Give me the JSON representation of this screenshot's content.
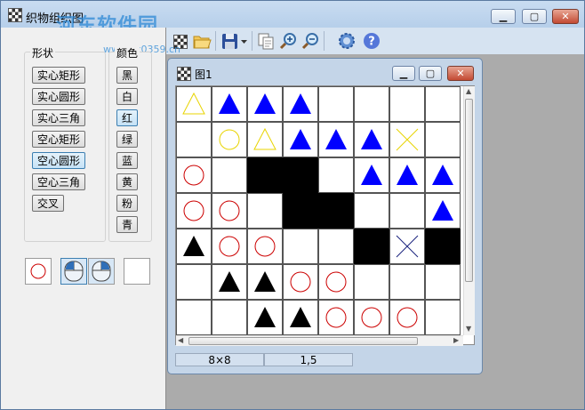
{
  "app": {
    "title": "织物组织图",
    "watermark": "河东软件园",
    "watermark_url": "www.pc0359.cn"
  },
  "toolbar": {
    "icons": [
      "grid-icon",
      "folder-open-icon",
      "save-icon",
      "dropdown-arrow-icon",
      "copy-icon",
      "zoom-in-icon",
      "zoom-out-icon",
      "settings-gear-icon",
      "help-icon"
    ]
  },
  "shape_group": {
    "label": "形状",
    "buttons": [
      "实心矩形",
      "实心圆形",
      "实心三角",
      "空心矩形",
      "空心圆形",
      "空心三角",
      "交叉"
    ],
    "selected": "空心圆形"
  },
  "color_group": {
    "label": "颜色",
    "buttons": [
      "黑",
      "白",
      "红",
      "绿",
      "蓝",
      "黄",
      "粉",
      "青"
    ],
    "selected": "红"
  },
  "child_window": {
    "title": "图1",
    "grid_size": 8,
    "cells": [
      [
        "tri-hollow-yellow",
        "tri-solid-blue",
        "tri-solid-blue",
        "tri-solid-blue",
        "",
        "",
        "",
        ""
      ],
      [
        "",
        "circle-hollow-yellow",
        "tri-hollow-yellow",
        "tri-solid-blue",
        "tri-solid-blue",
        "tri-solid-blue",
        "cross-yellow",
        ""
      ],
      [
        "circle-hollow-red",
        "",
        "rect-solid-black",
        "rect-solid-black",
        "",
        "tri-solid-blue",
        "tri-solid-blue",
        "tri-solid-blue"
      ],
      [
        "circle-hollow-red",
        "circle-hollow-red",
        "",
        "rect-solid-black",
        "rect-solid-black",
        "",
        "",
        "tri-solid-blue"
      ],
      [
        "tri-solid-black",
        "circle-hollow-red",
        "circle-hollow-red",
        "",
        "",
        "rect-solid-black",
        "cross-navy",
        "rect-solid-black"
      ],
      [
        "",
        "tri-solid-black",
        "tri-solid-black",
        "circle-hollow-red",
        "circle-hollow-red",
        "",
        "",
        ""
      ],
      [
        "",
        "",
        "tri-solid-black",
        "tri-solid-black",
        "circle-hollow-red",
        "circle-hollow-red",
        "circle-hollow-red",
        ""
      ]
    ],
    "status": {
      "size": "8×8",
      "position": "1,5"
    }
  },
  "colors": {
    "black": "#000000",
    "blue": "#0000ff",
    "red": "#cc0000",
    "yellow": "#e8d400",
    "navy": "#1a237e"
  }
}
